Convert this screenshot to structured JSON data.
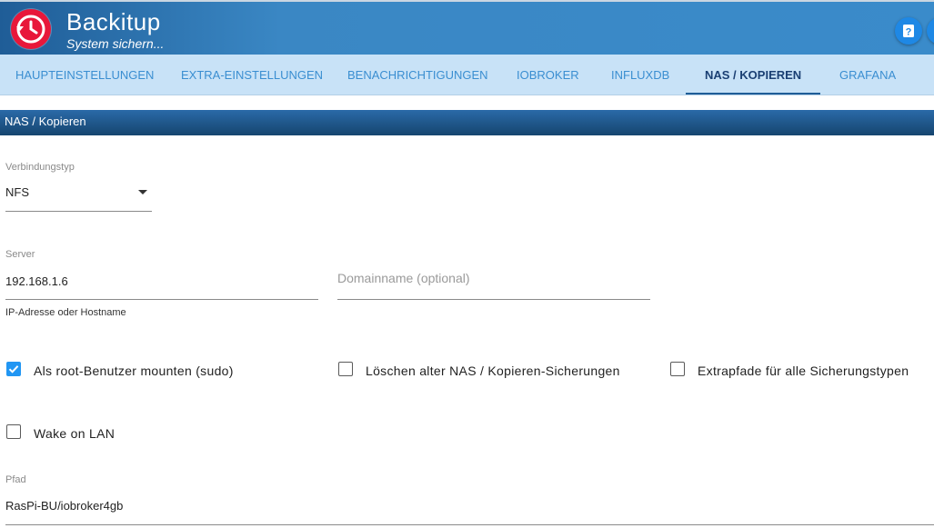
{
  "app": {
    "title": "Backitup",
    "subtitle": "System sichern...",
    "icons": {
      "logo": "backup-clock-icon",
      "help": "help-icon"
    }
  },
  "tabs": [
    {
      "label": "HAUPTEINSTELLUNGEN",
      "active": false
    },
    {
      "label": "EXTRA-EINSTELLUNGEN",
      "active": false
    },
    {
      "label": "BENACHRICHTIGUNGEN",
      "active": false
    },
    {
      "label": "IOBROKER",
      "active": false
    },
    {
      "label": "INFLUXDB",
      "active": false
    },
    {
      "label": "NAS / KOPIEREN",
      "active": true
    },
    {
      "label": "GRAFANA",
      "active": false
    }
  ],
  "section": {
    "title": "NAS / Kopieren"
  },
  "form": {
    "connection_type": {
      "label": "Verbindungstyp",
      "value": "NFS"
    },
    "server": {
      "label": "Server",
      "value": "192.168.1.6",
      "helper": "IP-Adresse oder Hostname"
    },
    "domain": {
      "placeholder": "Domainname (optional)"
    },
    "checkboxes": [
      {
        "label": "Als root-Benutzer mounten (sudo)",
        "checked": true
      },
      {
        "label": "Löschen alter NAS / Kopieren-Sicherungen",
        "checked": false
      },
      {
        "label": "Extrapfade für alle Sicherungstypen",
        "checked": false
      },
      {
        "label": "Wake on LAN",
        "checked": false
      }
    ],
    "path": {
      "label": "Pfad",
      "value": "RasPi-BU/iobroker4gb"
    }
  },
  "colors": {
    "header": "#3a87c4",
    "tab_bar": "#c8e2f7",
    "tab_text": "#3a8ed1",
    "tab_active": "#1a3f73",
    "checkbox_checked": "#2196f3",
    "logo_red": "#e8173a"
  }
}
